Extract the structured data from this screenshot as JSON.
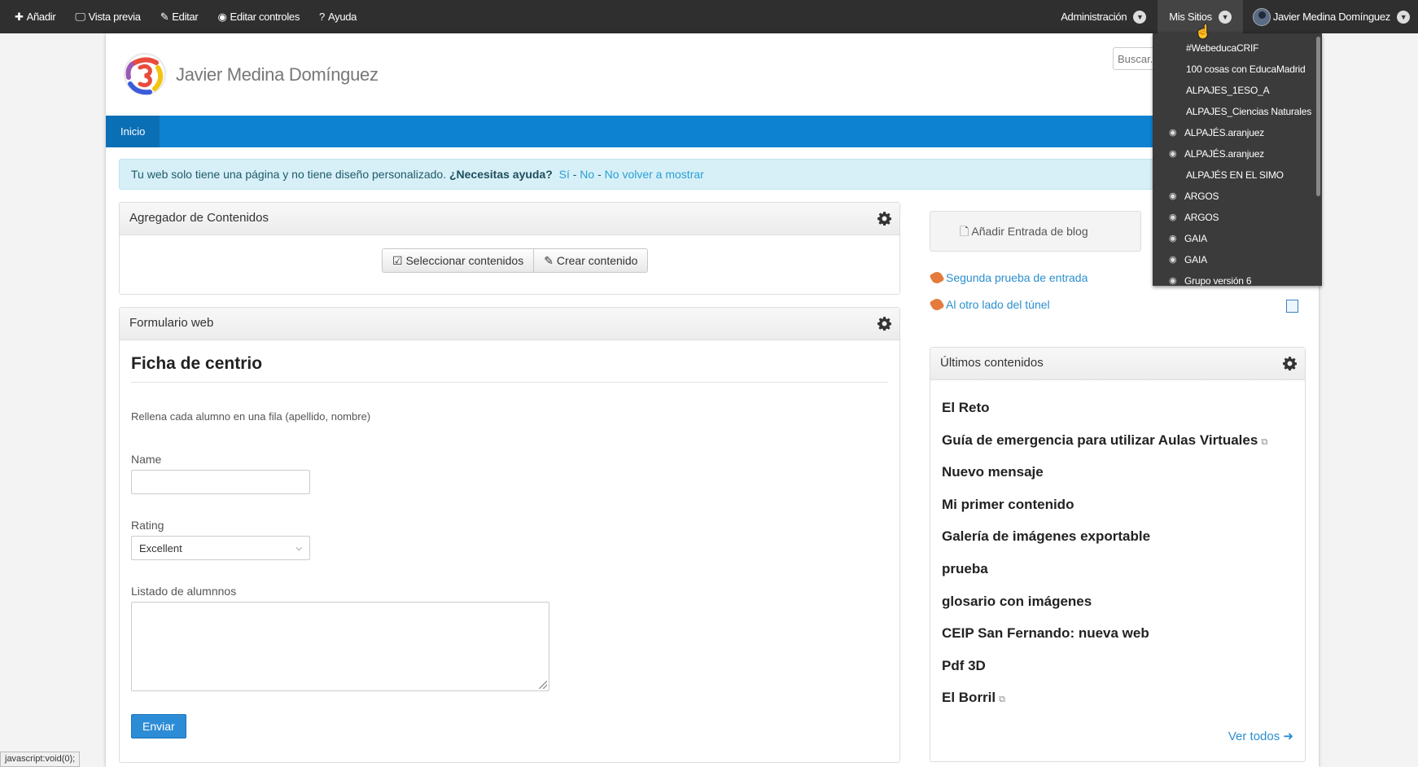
{
  "dockbar": {
    "add": "Añadir",
    "preview": "Vista previa",
    "edit": "Editar",
    "edit_controls": "Editar controles",
    "help": "Ayuda",
    "admin": "Administración",
    "my_sites": "Mis Sitios",
    "user_name": "Javier Medina Domínguez"
  },
  "header": {
    "site_title": "Javier Medina Domínguez",
    "search_placeholder": "Buscar..."
  },
  "nav": {
    "home": "Inicio"
  },
  "alert": {
    "text": "Tu web solo tiene una página y no tiene diseño personalizado.",
    "question": "¿Necesitas ayuda?",
    "yes": "Sí",
    "no": "No",
    "never": "No volver a mostrar",
    "sep": "-"
  },
  "content_aggregator": {
    "title": "Agregador de Contenidos",
    "select_btn": "Seleccionar contenidos",
    "create_btn": "Crear contenido"
  },
  "web_form": {
    "title": "Formulario web",
    "form_title": "Ficha de centrio",
    "description": "Rellena cada alumno en una fila (apellido, nombre)",
    "name_label": "Name",
    "name_value": "",
    "rating_label": "Rating",
    "rating_value": "Excellent",
    "list_label": "Listado de alumnnos",
    "list_value": "",
    "submit": "Enviar"
  },
  "blog": {
    "add_entry": "Añadir Entrada de blog",
    "entries": [
      "Segunda prueba de entrada",
      "Al otro lado del túnel"
    ]
  },
  "latest": {
    "title": "Últimos contenidos",
    "items": [
      {
        "title": "El Reto",
        "external": false
      },
      {
        "title": "Guía de emergencia para utilizar Aulas Virtuales",
        "external": true
      },
      {
        "title": "Nuevo mensaje",
        "external": false
      },
      {
        "title": "Mi primer contenido",
        "external": false
      },
      {
        "title": "Galería de imágenes exportable",
        "external": false
      },
      {
        "title": "prueba",
        "external": false
      },
      {
        "title": "glosario con imágenes",
        "external": false
      },
      {
        "title": "CEIP San Fernando: nueva web",
        "external": false
      },
      {
        "title": "Pdf 3D",
        "external": false
      },
      {
        "title": "El Borril",
        "external": true
      }
    ],
    "see_all": "Ver todos"
  },
  "sites_dropdown": [
    {
      "label": "#WebeducaCRIF",
      "icon": false
    },
    {
      "label": "100 cosas con EducaMadrid",
      "icon": false
    },
    {
      "label": "ALPAJES_1ESO_A",
      "icon": false
    },
    {
      "label": "ALPAJES_Ciencias Naturales",
      "icon": false
    },
    {
      "label": "ALPAJÉS.aranjuez",
      "icon": true
    },
    {
      "label": "ALPAJÉS.aranjuez",
      "icon": true
    },
    {
      "label": "ALPAJÉS EN EL SIMO",
      "icon": false
    },
    {
      "label": "ARGOS",
      "icon": true
    },
    {
      "label": "ARGOS",
      "icon": true
    },
    {
      "label": "GAIA",
      "icon": true
    },
    {
      "label": "GAIA",
      "icon": true
    },
    {
      "label": "Grupo versión 6",
      "icon": true
    }
  ],
  "status_bar": "javascript:void(0);",
  "colors": {
    "dockbar": "#2f2f2f",
    "nav": "#0d82d1",
    "link": "#2a8fd0",
    "primary_btn": "#2d8cd6",
    "alert_bg": "#d7f0f7"
  }
}
